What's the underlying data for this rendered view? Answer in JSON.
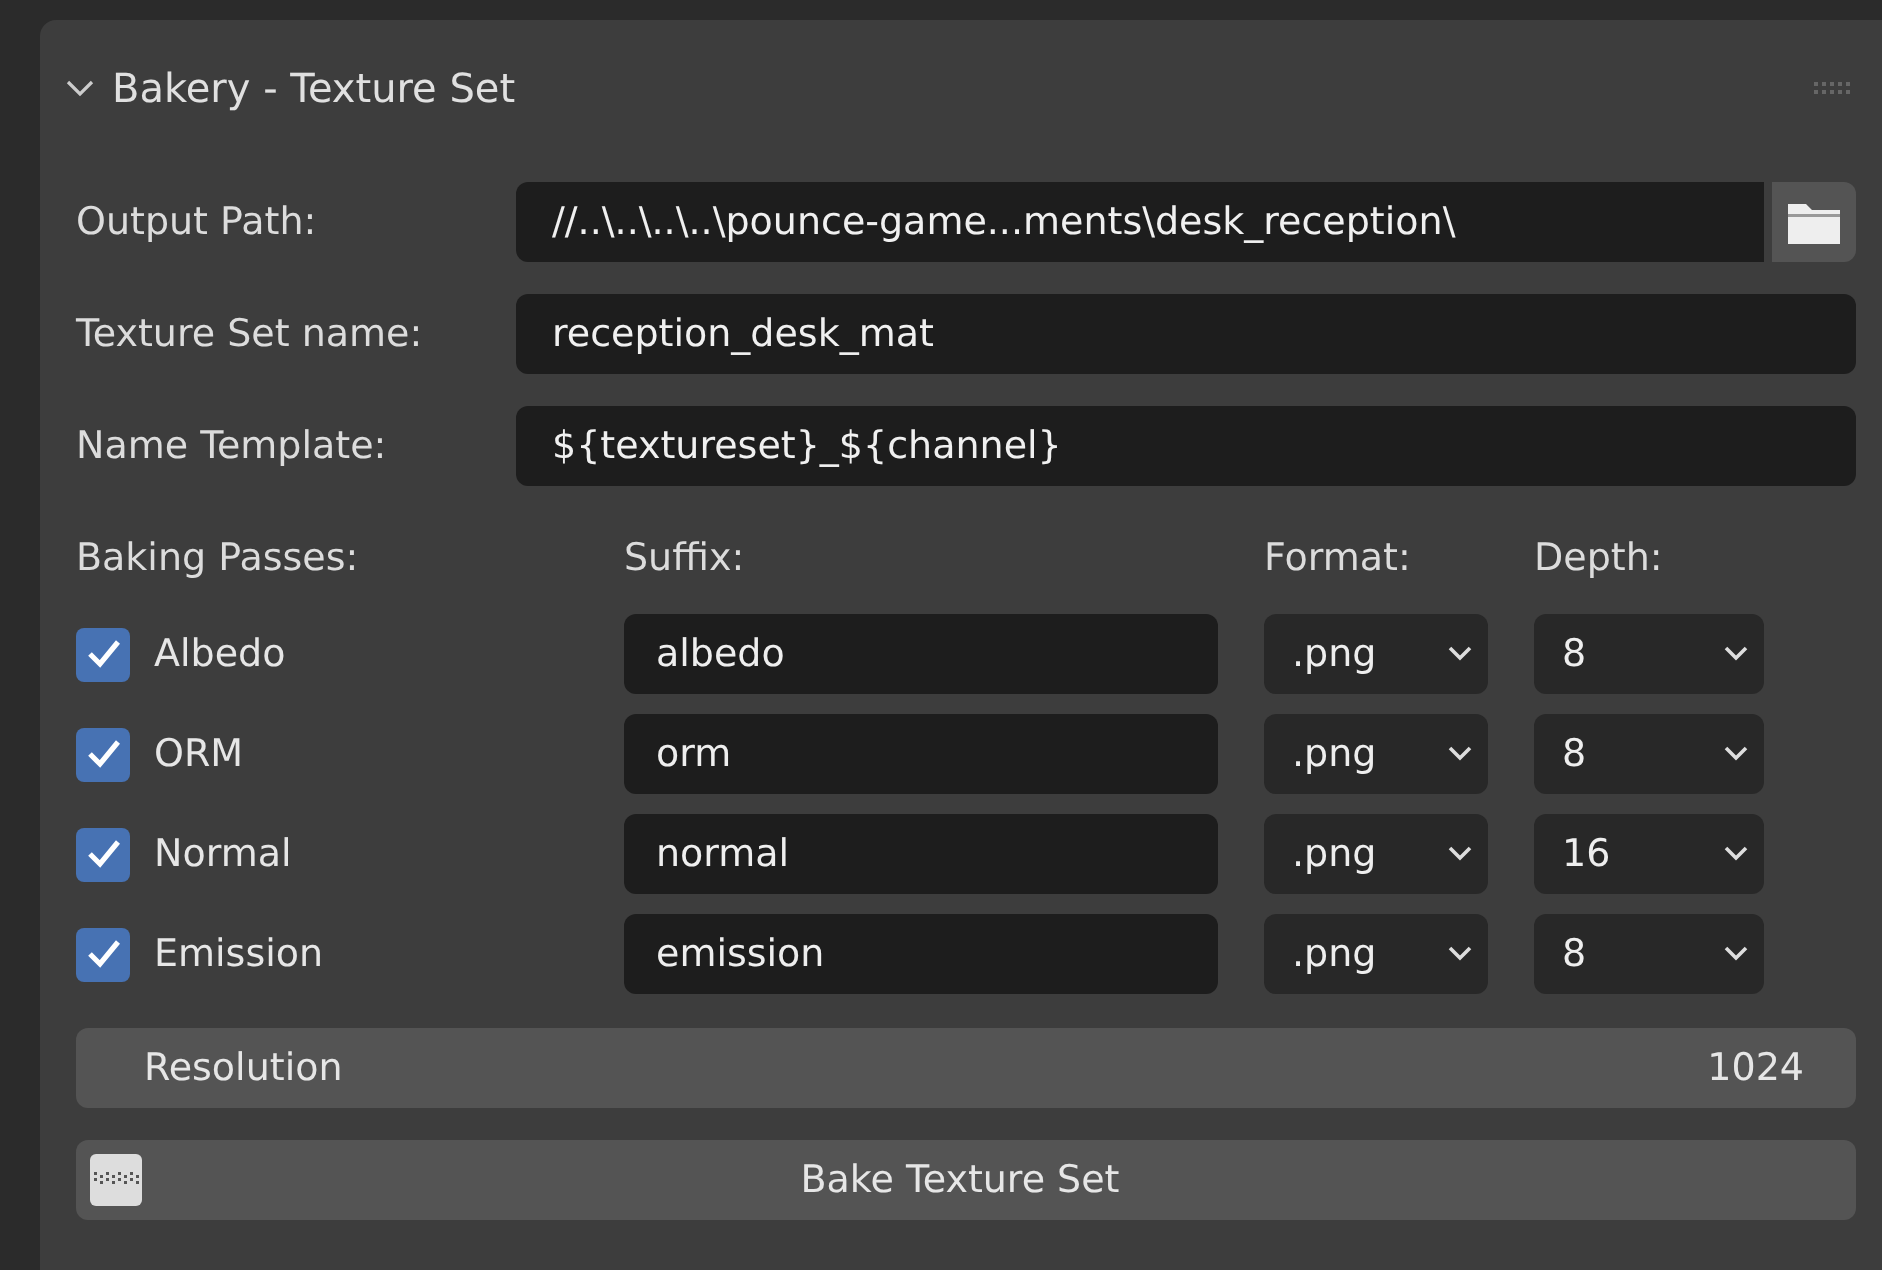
{
  "panel": {
    "title": "Bakery - Texture Set",
    "expanded": true
  },
  "fields": [
    {
      "label": "Output Path:",
      "value": "//..\\..\\..\\..\\pounce-game...ments\\desk_reception\\",
      "kind": "path"
    },
    {
      "label": "Texture Set name:",
      "value": "reception_desk_mat",
      "kind": "text"
    },
    {
      "label": "Name Template:",
      "value": "${textureset}_${channel}",
      "kind": "text"
    }
  ],
  "passes_header": {
    "passes": "Baking Passes:",
    "suffix": "Suffix:",
    "format": "Format:",
    "depth": "Depth:"
  },
  "passes": [
    {
      "name": "Albedo",
      "checked": true,
      "suffix": "albedo",
      "format": ".png",
      "depth": "8"
    },
    {
      "name": "ORM",
      "checked": true,
      "suffix": "orm",
      "format": ".png",
      "depth": "8"
    },
    {
      "name": "Normal",
      "checked": true,
      "suffix": "normal",
      "format": ".png",
      "depth": "16"
    },
    {
      "name": "Emission",
      "checked": true,
      "suffix": "emission",
      "format": ".png",
      "depth": "8"
    }
  ],
  "resolution": {
    "label": "Resolution",
    "value": "1024"
  },
  "bake_button": {
    "label": "Bake Texture Set"
  }
}
